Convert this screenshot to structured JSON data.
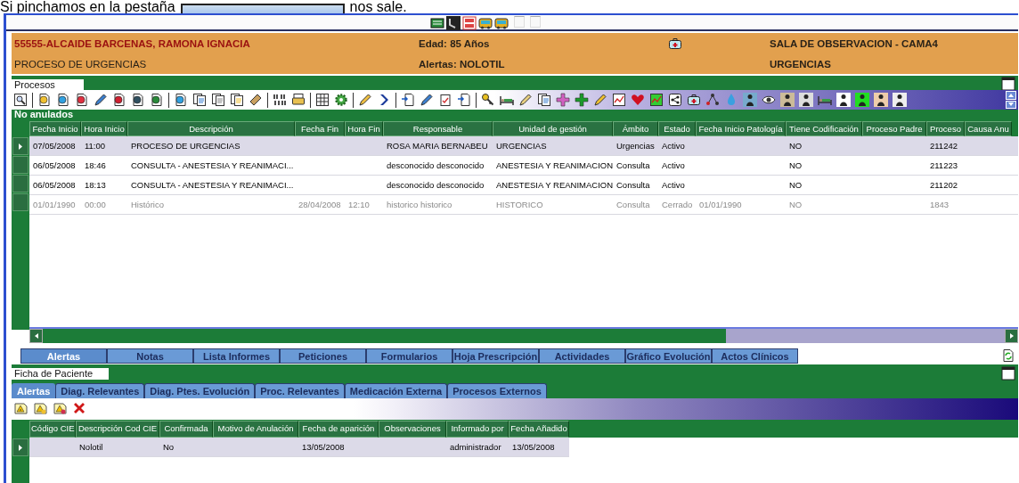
{
  "caption": {
    "before": "Si pinchamos en la pestaña",
    "after": "nos sale."
  },
  "patient": {
    "name": "55555-ALCAIDE BARCENAS, RAMONA IGNACIA",
    "process": "PROCESO DE URGENCIAS",
    "age": "Edad: 85 Años",
    "alerts": "Alertas: NOLOTIL",
    "location": "SALA DE OBSERVACION - CAMA4",
    "service": "URGENCIAS"
  },
  "procesos": {
    "title": "Procesos",
    "group": "No anulados",
    "columns": [
      "Fecha Inicio",
      "Hora Inicio",
      "Descripción",
      "Fecha Fin",
      "Hora Fin",
      "Responsable",
      "Unidad de gestión",
      "Ámbito",
      "Estado",
      "Fecha Inicio Patología",
      "Tiene Codificación",
      "Proceso Padre",
      "Proceso",
      "Causa Anu"
    ],
    "rows": [
      {
        "selected": true,
        "greyed": false,
        "cells": [
          "07/05/2008",
          "11:00",
          "PROCESO DE URGENCIAS",
          null,
          null,
          "ROSA MARIA BERNABEU",
          "URGENCIAS",
          "Urgencias",
          "Activo",
          null,
          "NO",
          null,
          "211242",
          null
        ]
      },
      {
        "selected": false,
        "greyed": false,
        "cells": [
          "06/05/2008",
          "18:46",
          "CONSULTA - ANESTESIA Y REANIMACI...",
          null,
          null,
          "desconocido desconocido",
          "ANESTESIA Y REANIMACION",
          "Consulta",
          "Activo",
          null,
          "NO",
          null,
          "211223",
          null
        ]
      },
      {
        "selected": false,
        "greyed": false,
        "cells": [
          "06/05/2008",
          "18:13",
          "CONSULTA - ANESTESIA Y REANIMACI...",
          null,
          null,
          "desconocido desconocido",
          "ANESTESIA Y REANIMACION",
          "Consulta",
          "Activo",
          null,
          "NO",
          null,
          "211202",
          null
        ]
      },
      {
        "selected": false,
        "greyed": true,
        "cells": [
          "01/01/1990",
          "00:00",
          "Histórico",
          "28/04/2008",
          "12:10",
          "historico historico",
          "HISTORICO",
          "Consulta",
          "Cerrado",
          "01/01/1990",
          "NO",
          null,
          "1843",
          null
        ]
      }
    ]
  },
  "tabs": [
    {
      "label": "Alertas",
      "selected": true
    },
    {
      "label": "Notas",
      "selected": false
    },
    {
      "label": "Lista Informes",
      "selected": false
    },
    {
      "label": "Peticiones",
      "selected": false
    },
    {
      "label": "Formularios",
      "selected": false
    },
    {
      "label": "Hoja Prescripción",
      "selected": false
    },
    {
      "label": "Actividades",
      "selected": false
    },
    {
      "label": "Gráfico Evolución",
      "selected": false
    },
    {
      "label": "Actos Clínicos",
      "selected": false
    }
  ],
  "ficha": {
    "title": "Ficha de Paciente",
    "subtabs": [
      {
        "label": "Alertas",
        "selected": true
      },
      {
        "label": "Diag. Relevantes",
        "selected": false
      },
      {
        "label": "Diag. Ptes. Evolución",
        "selected": false
      },
      {
        "label": "Proc. Relevantes",
        "selected": false
      },
      {
        "label": "Medicación Externa",
        "selected": false
      },
      {
        "label": "Procesos Externos",
        "selected": false
      }
    ],
    "columns": [
      "Código CIE",
      "Descripción Cod CIE",
      "Confirmada",
      "Motivo de Anulación",
      "Fecha de aparición",
      "Observaciones",
      "Informado por",
      "Fecha Añadido"
    ],
    "rows": [
      {
        "selected": true,
        "greyed": false,
        "cells": [
          null,
          "Nolotil",
          "No",
          null,
          "13/05/2008",
          null,
          "administrador",
          "13/05/2008"
        ]
      }
    ]
  }
}
